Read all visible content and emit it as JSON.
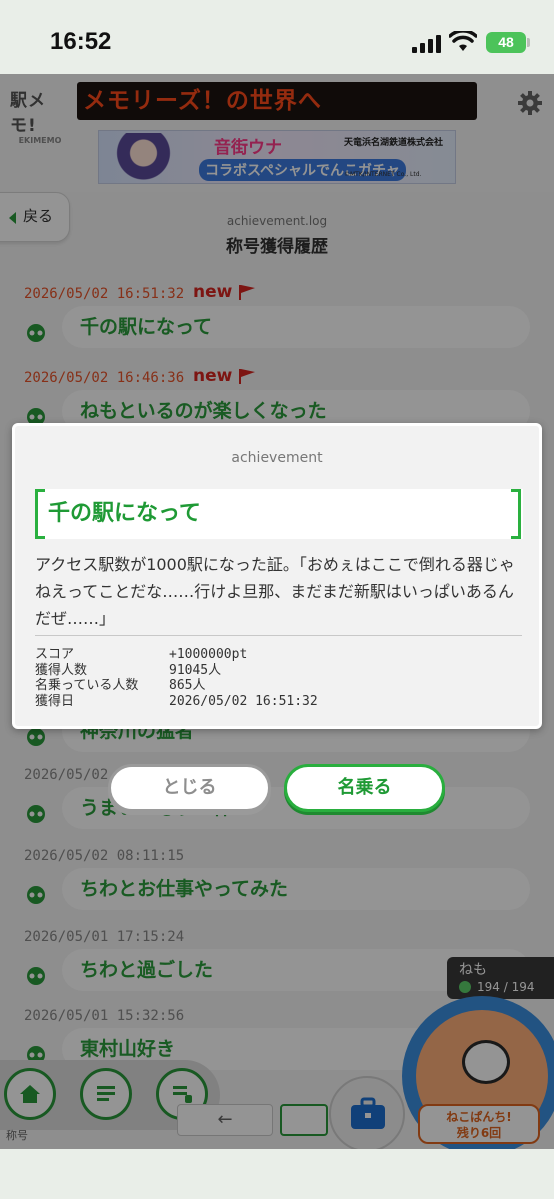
{
  "status": {
    "time": "16:52",
    "battery": "48"
  },
  "header": {
    "logo_line1": "駅メモ!",
    "logo_line2": "EKIMEMO",
    "ticker": "メモリーズ！の世界へ",
    "banner": {
      "title": "音街ウナ",
      "company": "天竜浜名湖鉄道株式会社",
      "caption": "コラボスペシャルでんこガチャ",
      "copyright": "©MTK/INTERNET Co., Ltd."
    }
  },
  "nav": {
    "back_label": "戻る"
  },
  "log": {
    "title_en": "achievement.log",
    "title_ja": "称号獲得履歴",
    "new_label": "new",
    "entries": [
      {
        "date": "2026/05/02 16:51:32",
        "title": "千の駅になって",
        "is_new": true
      },
      {
        "date": "2026/05/02 16:46:36",
        "title": "ねもといるのが楽しくなった",
        "is_new": true
      },
      {
        "date": "",
        "title": "神奈川の猛者",
        "is_new": false
      },
      {
        "date": "2026/05/02",
        "title": "うまい！もう一杯！",
        "is_new": false
      },
      {
        "date": "2026/05/02 08:11:15",
        "title": "ちわとお仕事やってみた",
        "is_new": false
      },
      {
        "date": "2026/05/01 17:15:24",
        "title": "ちわと過ごした",
        "is_new": false
      },
      {
        "date": "2026/05/01 15:32:56",
        "title": "東村山好き",
        "is_new": false
      }
    ]
  },
  "character": {
    "name": "ねも",
    "hp": "194 / 194"
  },
  "nekopunch": {
    "line1": "ねこぱんち!",
    "line2": "残り6回"
  },
  "footer": {
    "label": "称号",
    "pager_prev": "←"
  },
  "modal": {
    "header": "achievement",
    "title": "千の駅になって",
    "description": "アクセス駅数が1000駅になった証。「おめぇはここで倒れる器じゃねえってことだな……行けよ旦那、まだまだ新駅はいっぱいあるんだぜ……」",
    "stats": [
      {
        "label": "スコア",
        "value": "+1000000pt"
      },
      {
        "label": "獲得人数",
        "value": "91045人"
      },
      {
        "label": "名乗っている人数",
        "value": "865人"
      },
      {
        "label": "獲得日",
        "value": "2026/05/02 16:51:32"
      }
    ],
    "close_label": "とじる",
    "claim_label": "名乗る"
  },
  "colors": {
    "accent": "#1f9a35",
    "new": "#d8251f",
    "ticker": "#ff4a1a"
  }
}
